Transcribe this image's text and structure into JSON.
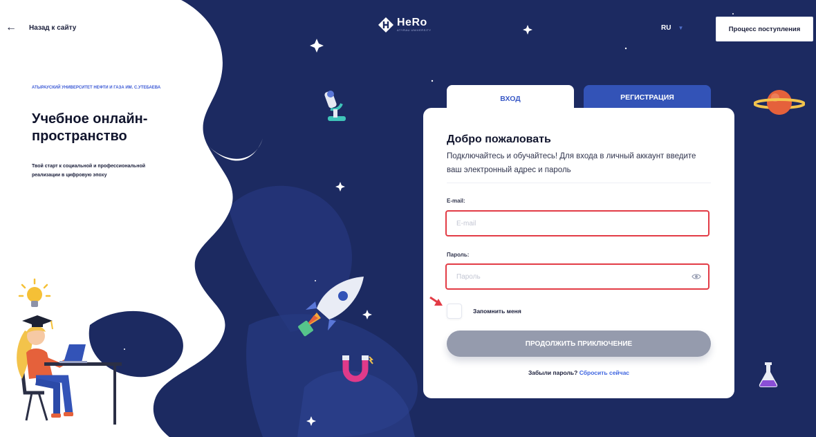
{
  "header": {
    "back_label": "Назад к сайту",
    "logo_text": "HeRo",
    "logo_subtitle": "ATYRAU UNIVERSITY",
    "language": "RU",
    "admission_button": "Процесс поступления"
  },
  "hero": {
    "university": "АТЫРАУСКИЙ УНИВЕРСИТЕТ НЕФТИ И ГАЗА ИМ. С.УТЕБАЕВА",
    "title": "Учебное онлайн-пространство",
    "subtitle": "Твой старт к социальной и профессиональной реализации в цифровую эпоху"
  },
  "tabs": [
    {
      "label": "ВХОД",
      "active": true
    },
    {
      "label": "РЕГИСТРАЦИЯ",
      "active": false
    }
  ],
  "form": {
    "welcome": "Добро пожаловать",
    "description": "Подключайтесь и обучайтесь! Для входа в личный аккаунт введите ваш электронный адрес и пароль",
    "email_label": "E-mail:",
    "email_placeholder": "E-mail",
    "email_value": "",
    "password_label": "Пароль:",
    "password_placeholder": "Пароль",
    "password_value": "",
    "remember_label": "Запомнить меня",
    "remember_checked": false,
    "submit_label": "ПРОДОЛЖИТЬ ПРИКЛЮЧЕНИЕ",
    "forgot_text": "Забыли пароль?",
    "reset_link": "Сбросить сейчас"
  },
  "colors": {
    "space_bg": "#1c2a61",
    "accent_blue": "#3353b7",
    "error_border": "#e23b45",
    "submit_disabled": "#959bad"
  },
  "icons": [
    "back-arrow-icon",
    "hero-logo-icon",
    "chevron-down-icon",
    "eye-icon",
    "microscope-icon",
    "planet-icon",
    "rocket-icon",
    "magnet-icon",
    "flask-icon",
    "lightbulb-icon",
    "student-illustration",
    "red-pointer-arrow-icon"
  ]
}
